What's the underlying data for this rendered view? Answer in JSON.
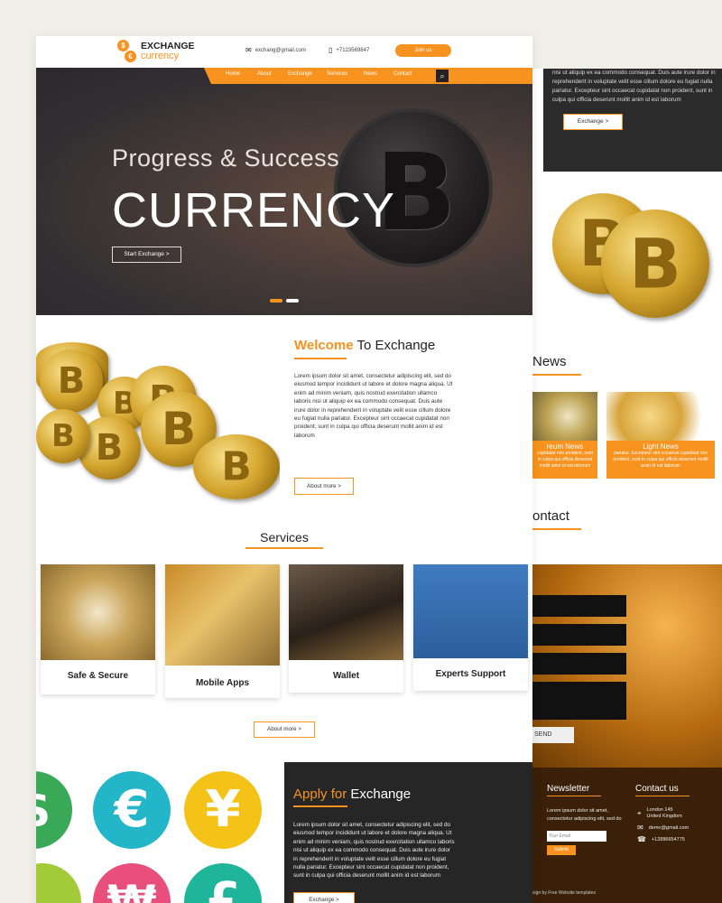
{
  "header": {
    "logo_line1": "EXCHANGE",
    "logo_line2": "currency",
    "email": "exchang@gmail.com",
    "phone": "+7123569847",
    "join_label": "Join us"
  },
  "nav": {
    "items": [
      "Home",
      "About",
      "Exchange",
      "Services",
      "News",
      "Contact"
    ]
  },
  "hero": {
    "subtitle": "Progress & Success",
    "title": "CURRENCY",
    "cta_label": "Start Exchange >"
  },
  "welcome": {
    "title_highlight": "Welcome",
    "title_rest": " To Exchange",
    "body": "Lorem ipsum dolor sit amet, consectetur adipiscing elit, sed do eiusmod tempor incididunt ut labore et dolore magna aliqua. Ut enim ad minim veniam, quis nostrud exercitation ullamco laboris nisi ut aliquip ex ea commodo consequat. Duis aute irure dolor in reprehenderit in voluptate velit esse cillum dolore eu fugiat nulla pariatur. Excepteur sint occaecat cupidatat non proident, sunt in culpa qui officia deserunt mollit anim id est laborum",
    "button_label": "About more >"
  },
  "services": {
    "title": "Services",
    "cards": [
      "Safe & Secure",
      "Mobile Apps",
      "Wallet",
      "Experts Support"
    ],
    "button_label": "About more >"
  },
  "apply": {
    "title_highlight": "Apply for",
    "title_rest": " Exchange",
    "body": "Lorem ipsum dolor sit amet, consectetur adipiscing elit, sed do eiusmod tempor incididunt ut labore et dolore magna aliqua. Ut enim ad minim veniam, quis nostrud exercitation ullamco laboris nisi ut aliquip ex ea commodo consequat. Duis aute irure dolor in reprehenderit in voluptate velit esse cillum dolore eu fugiat nulla pariatur. Excepteur sint occaecat cupidatat non proident, sunt in culpa qui officia deserunt mollit anim id est laborum",
    "button_label": "Exchange >"
  },
  "back_page": {
    "top_text": "nisi ut aliquip ex ea commodo consequat. Duis aute irure dolor in reprehenderit in voluptate velit esse cillum dolore eu fugiat nulla pariatur. Excepteur sint occaecat cupidatat non proident, sunt in culpa qui officia deserunt mollit anim id est laborum",
    "top_button": "Exchange >",
    "news_title": "News",
    "news": [
      {
        "title": "reum News",
        "text": "cupidatat non proident, sunt in culpa qui officia deserunt mollit anim id est laborum"
      },
      {
        "title": "Light News",
        "text": "pariatur. Excepteur sint occaecat cupidatat non proident, sunt in culpa qui officia deserunt mollit anim id est laborum"
      }
    ],
    "contact_title": "ontact",
    "send_label": "SEND",
    "newsletter_title": "Newsletter",
    "newsletter_text": "Lorem ipsum dolor sit amet, consectetur adipiscing elit, sed do",
    "email_placeholder": "Your Email",
    "submit_label": "Submit",
    "contactus_title": "Contact us",
    "address_line1": "London 145",
    "address_line2": "United Kingdom",
    "contact_email": "demo@gmail.com",
    "contact_phone": "+12886654775",
    "credit": "sign by Free Website templates"
  },
  "colors": {
    "accent": "#f7931e",
    "dark": "#262626",
    "footer": "#3a2008"
  }
}
